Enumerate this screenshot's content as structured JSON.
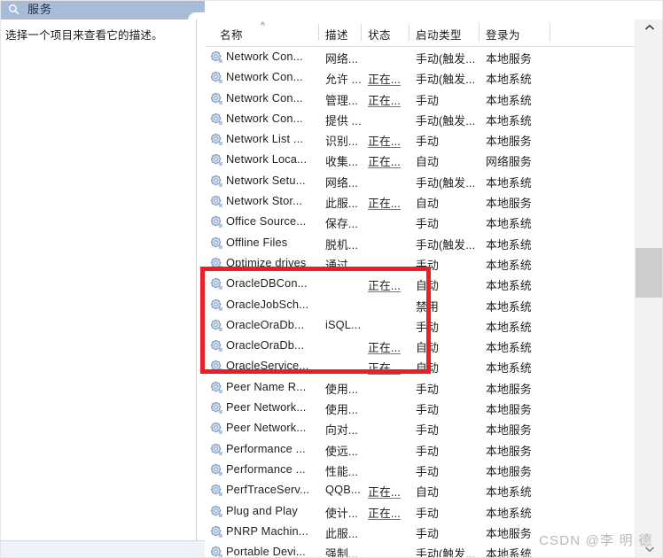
{
  "window": {
    "title": "服务",
    "title_icon": "services-search-icon",
    "accent_color": "#a8bcd8"
  },
  "left_panel": {
    "description": "选择一个项目来查看它的描述。"
  },
  "list": {
    "sort_indicator": "^",
    "columns": [
      {
        "key": "name",
        "label": "名称"
      },
      {
        "key": "desc",
        "label": "描述"
      },
      {
        "key": "state",
        "label": "状态"
      },
      {
        "key": "start",
        "label": "启动类型"
      },
      {
        "key": "logon",
        "label": "登录为"
      }
    ],
    "rows": [
      {
        "name": "Network Con...",
        "desc": "网络...",
        "state": "",
        "start": "手动(触发...",
        "logon": "本地服务"
      },
      {
        "name": "Network Con...",
        "desc": "允许 ...",
        "state": "正在...",
        "start": "手动(触发...",
        "logon": "本地系统"
      },
      {
        "name": "Network Con...",
        "desc": "管理...",
        "state": "正在...",
        "start": "手动",
        "logon": "本地系统"
      },
      {
        "name": "Network Con...",
        "desc": "提供 ...",
        "state": "",
        "start": "手动(触发...",
        "logon": "本地系统"
      },
      {
        "name": "Network List ...",
        "desc": "识别...",
        "state": "正在...",
        "start": "手动",
        "logon": "本地服务"
      },
      {
        "name": "Network Loca...",
        "desc": "收集...",
        "state": "正在...",
        "start": "自动",
        "logon": "网络服务"
      },
      {
        "name": "Network Setu...",
        "desc": "网络...",
        "state": "",
        "start": "手动(触发...",
        "logon": "本地系统"
      },
      {
        "name": "Network Stor...",
        "desc": "此服...",
        "state": "正在...",
        "start": "自动",
        "logon": "本地服务"
      },
      {
        "name": "Office Source...",
        "desc": "保存...",
        "state": "",
        "start": "手动",
        "logon": "本地系统"
      },
      {
        "name": "Offline Files",
        "desc": "脱机...",
        "state": "",
        "start": "手动(触发...",
        "logon": "本地系统"
      },
      {
        "name": "Optimize drives",
        "desc": "通过...",
        "state": "",
        "start": "手动",
        "logon": "本地系统"
      },
      {
        "name": "OracleDBCon...",
        "desc": "",
        "state": "正在...",
        "start": "自动",
        "logon": "本地系统"
      },
      {
        "name": "OracleJobSch...",
        "desc": "",
        "state": "",
        "start": "禁用",
        "logon": "本地系统"
      },
      {
        "name": "OracleOraDb...",
        "desc": "iSQL...",
        "state": "",
        "start": "手动",
        "logon": "本地系统"
      },
      {
        "name": "OracleOraDb...",
        "desc": "",
        "state": "正在...",
        "start": "自动",
        "logon": "本地系统"
      },
      {
        "name": "OracleService...",
        "desc": "",
        "state": "正在...",
        "start": "自动",
        "logon": "本地系统"
      },
      {
        "name": "Peer Name R...",
        "desc": "使用...",
        "state": "",
        "start": "手动",
        "logon": "本地服务"
      },
      {
        "name": "Peer Network...",
        "desc": "使用...",
        "state": "",
        "start": "手动",
        "logon": "本地服务"
      },
      {
        "name": "Peer Network...",
        "desc": "向对...",
        "state": "",
        "start": "手动",
        "logon": "本地服务"
      },
      {
        "name": "Performance ...",
        "desc": "使远...",
        "state": "",
        "start": "手动",
        "logon": "本地服务"
      },
      {
        "name": "Performance ...",
        "desc": "性能...",
        "state": "",
        "start": "手动",
        "logon": "本地服务"
      },
      {
        "name": "PerfTraceServ...",
        "desc": "QQB...",
        "state": "正在...",
        "start": "自动",
        "logon": "本地系统"
      },
      {
        "name": "Plug and Play",
        "desc": "使计...",
        "state": "正在...",
        "start": "手动",
        "logon": "本地系统"
      },
      {
        "name": "PNRP Machin...",
        "desc": "此服...",
        "state": "",
        "start": "手动",
        "logon": "本地服务"
      },
      {
        "name": "Portable Devi...",
        "desc": "强制...",
        "state": "",
        "start": "手动(触发...",
        "logon": "本地系统"
      }
    ]
  },
  "annotation": {
    "highlight_color": "#ee1c24",
    "highlight_rows": [
      "OracleDBCon...",
      "OracleJobSch...",
      "OracleOraDb...",
      "OracleOraDb...",
      "OracleService..."
    ]
  },
  "scrollbar": {
    "up_arrow": "︿",
    "down_arrow": "﹀"
  },
  "watermark": {
    "text": "CSDN @李 明 德"
  }
}
